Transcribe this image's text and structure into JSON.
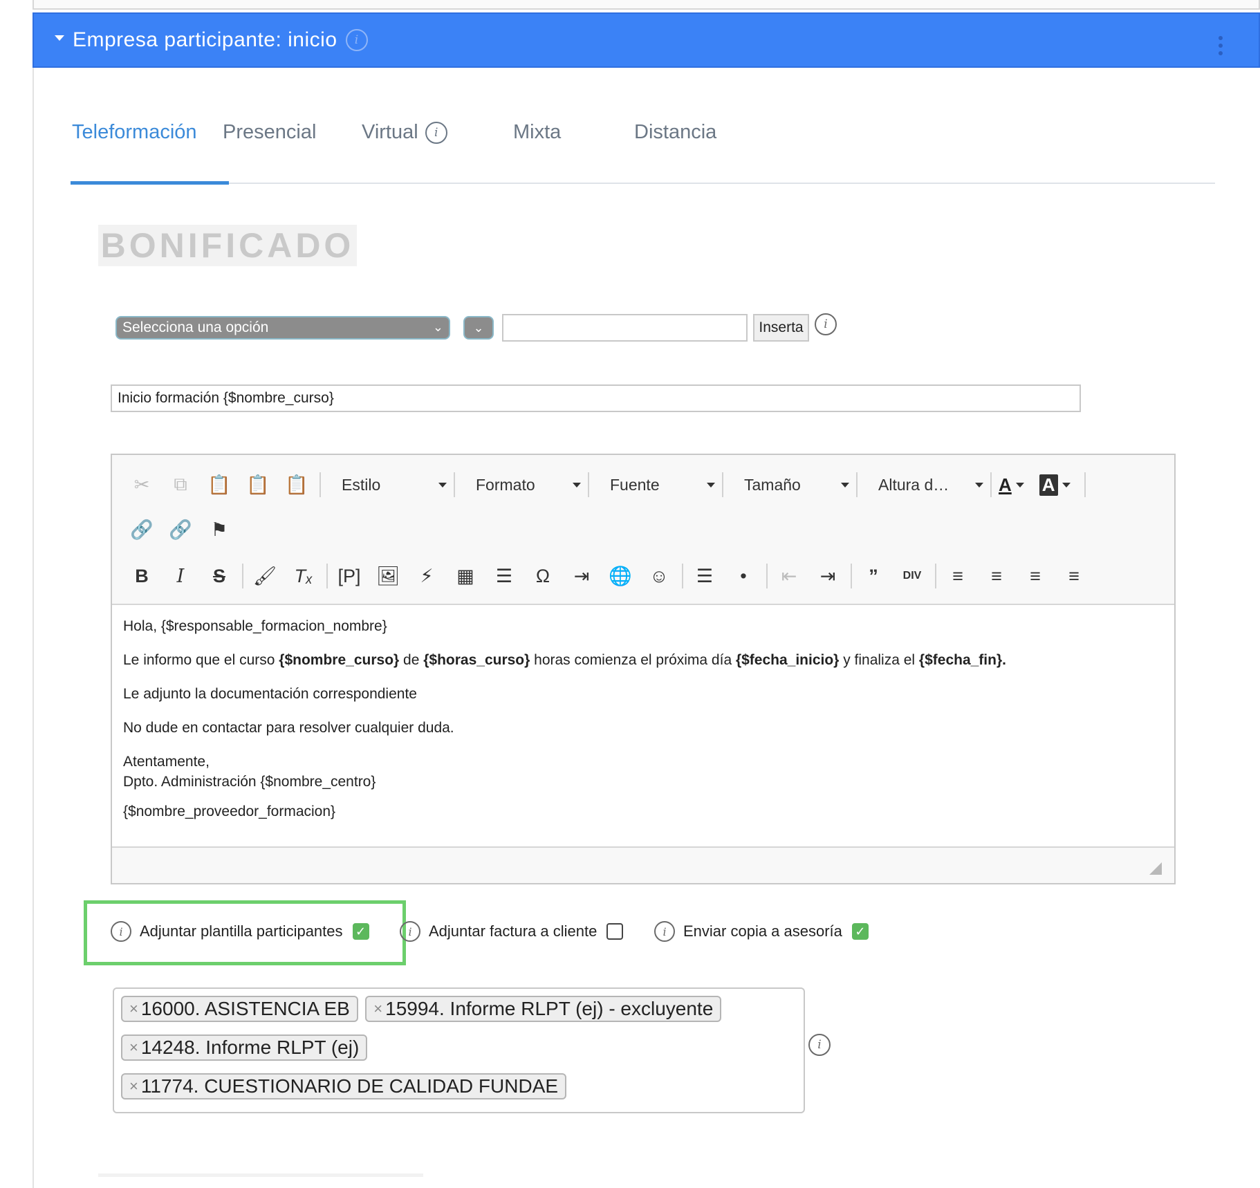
{
  "panel": {
    "title": "Empresa participante: inicio"
  },
  "tabs": [
    {
      "label": "Teleformación",
      "active": true
    },
    {
      "label": "Presencial",
      "active": false
    },
    {
      "label": "Virtual",
      "active": false,
      "has_info": true
    },
    {
      "label": "Mixta",
      "active": false
    },
    {
      "label": "Distancia",
      "active": false
    }
  ],
  "badge": "BONIFICADO",
  "variable_row": {
    "select_value": "Selecciona una opción",
    "input_value": "",
    "insert_button": "Inserta"
  },
  "subject": "Inicio formación {$nombre_curso}",
  "editor": {
    "toolbar": {
      "style_combo": "Estilo",
      "format_combo": "Formato",
      "font_combo": "Fuente",
      "size_combo": "Tamaño",
      "line_height_combo": "Altura d…",
      "text_color_glyph": "A",
      "bg_color_glyph": "A"
    },
    "body": {
      "greeting": "Hola, {$responsable_formacion_nombre}",
      "line2": {
        "t1": "Le informo que el curso ",
        "b1": "{$nombre_curso}",
        "t2": " de ",
        "b2": "{$horas_curso}",
        "t3": " horas comienza el próxima día ",
        "b3": "{$fecha_inicio}",
        "t4": " y finaliza el ",
        "b4": "{$fecha_fin}."
      },
      "line3": "Le adjunto la documentación correspondiente",
      "line4": "No dude en contactar para resolver cualquier duda.",
      "line5a": "Atentamente,",
      "line5b": "Dpto. Administración {$nombre_centro}",
      "line6": "{$nombre_proveedor_formacion}"
    }
  },
  "options": [
    {
      "label": "Adjuntar plantilla participantes",
      "checked": true
    },
    {
      "label": "Adjuntar factura a cliente",
      "checked": false
    },
    {
      "label": "Enviar copia a asesoría",
      "checked": true
    }
  ],
  "attachments": [
    "16000. ASISTENCIA EB",
    "15994. Informe RLPT (ej) - excluyente",
    "14248. Informe RLPT (ej)",
    "11774. CUESTIONARIO DE CALIDAD FUNDAE"
  ],
  "colors": {
    "header_bg": "#3b82f6",
    "tab_active": "#3b8ad9",
    "highlight": "#6ccf6c",
    "checkbox_checked": "#5cb85c"
  }
}
